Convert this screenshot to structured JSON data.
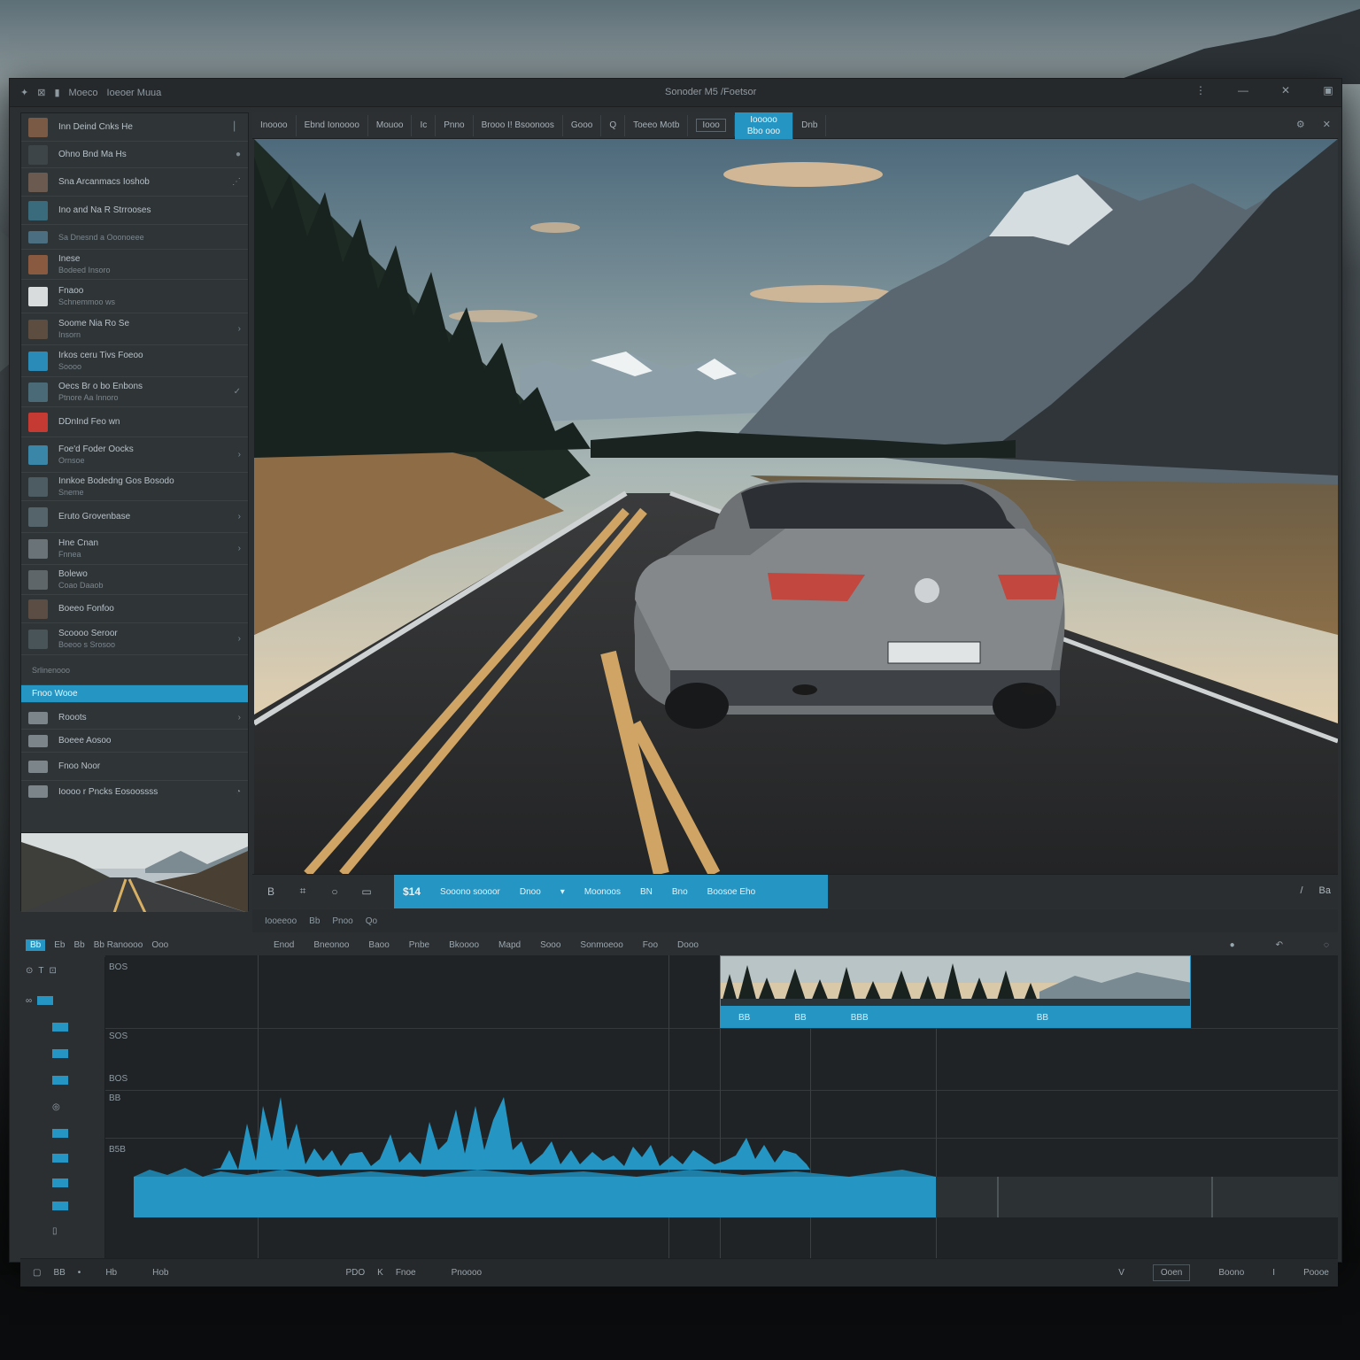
{
  "app": {
    "menu_left": [
      "Moeco",
      "Ioeoer Muua"
    ],
    "title": "Sonoder M5 /Foetsor",
    "accent": "#2596c4"
  },
  "media_list": {
    "items": [
      {
        "label": "Inn Deind Cnks He",
        "sub": "",
        "icon": "chevron-right"
      },
      {
        "label": "Ohno Bnd Ma Hs",
        "sub": "",
        "icon": "dot"
      },
      {
        "label": "Sna Arcanmacs Ioshob",
        "sub": "",
        "icon": "dots"
      },
      {
        "label": "Ino and Na R Strrooses",
        "sub": "",
        "icon": ""
      },
      {
        "label": "Sa Dnesnd a Ooonoeee",
        "sub": "",
        "icon": ""
      },
      {
        "label": "Inese",
        "sub": "Bodeed Insoro",
        "icon": ""
      },
      {
        "label": "Fnaoo",
        "sub": "Schnemmoo ws",
        "icon": ""
      },
      {
        "label": "Soome Nia Ro Se",
        "sub": "Insorn",
        "icon": ""
      },
      {
        "label": "Irkos ceru Tivs Foeoo",
        "sub": "Soooo",
        "icon": ""
      },
      {
        "label": "Oecs Br o bo Enbons",
        "sub": "Ptnore Aa Innoro",
        "icon": "pin"
      },
      {
        "label": "DDnInd Feo wn",
        "sub": "",
        "icon": ""
      },
      {
        "label": "Foe'd Foder Oocks",
        "sub": "Ornsoe",
        "icon": ""
      },
      {
        "label": "Innkoe Bodedng Gos Bosodo",
        "sub": "Sneme",
        "icon": ""
      },
      {
        "label": "Eruto Grovenbase",
        "sub": "",
        "icon": ""
      },
      {
        "label": "Hne Cnan",
        "sub": "Fnnea",
        "icon": ""
      },
      {
        "label": "Bolewo",
        "sub": "Coao Daaob",
        "icon": ""
      },
      {
        "label": "Boeeo Fonfoo",
        "sub": "Boeoo s Srosoo",
        "icon": ""
      },
      {
        "label": "Scoooo Seroor",
        "sub": "",
        "icon": ""
      },
      {
        "label": "Srlinenooo",
        "sub": "",
        "icon": ""
      },
      {
        "label": "Fnoo Wooe",
        "sub": "Rooots",
        "icon": ""
      },
      {
        "label": "Boeee Aosoo",
        "sub": "",
        "icon": ""
      },
      {
        "label": "Fnoo Noor",
        "sub": "",
        "icon": ""
      },
      {
        "label": "Ioooo r Pncks Eosoossss",
        "sub": "",
        "icon": "pin"
      }
    ]
  },
  "toolbar": {
    "buttons": [
      "Inoooo",
      "Ebnd Ionoooo",
      "Mouoo",
      "Ic",
      "Pnno",
      "Brooo I! Bsoonoos",
      "Gooo",
      "Q",
      "Toeeo Motb"
    ],
    "boxed": "Iooo",
    "active_top": "Iooooo",
    "active_bottom": "Bbo ooo",
    "after_active": "Dnb",
    "right_icons": [
      "gear-icon",
      "close-icon"
    ]
  },
  "transport": {
    "scrub_value": "$14",
    "scrub_labels": [
      "Sooono soooor",
      "Dnoo",
      "Moonoos",
      "BN",
      "Bno",
      "Boosoe Eho"
    ],
    "right": [
      "/",
      "Ba"
    ]
  },
  "subbar": {
    "items": [
      "Iooeeoo",
      "Bb",
      "Pnoo",
      "Qo"
    ]
  },
  "timeline_tabs": {
    "tabs": [
      "Bb",
      "Eb",
      "Bb",
      "Bb Ranoooo",
      "Ooo"
    ]
  },
  "timeline_header": {
    "labels": [
      "Enod",
      "Bneonoo",
      "Baoo",
      "Pnbe",
      "Bkoooo",
      "Mapd",
      "Sooo",
      "Sonmoeoo",
      "Foo",
      "Dooo"
    ]
  },
  "track_labels": [
    "BOS",
    "SOS",
    "BOS",
    "BB",
    "B5B"
  ],
  "timeline": {
    "clip_labels": [
      "BB",
      "BB",
      "BBB",
      "BB"
    ]
  },
  "status": {
    "left": [
      "BB",
      "•",
      "Hb",
      "Hob"
    ],
    "mid": [
      "PDO",
      "K",
      "Fnoe",
      "Pnoooo"
    ],
    "right": [
      "V",
      "Ooen",
      "Boono",
      "I",
      "Poooe"
    ]
  }
}
